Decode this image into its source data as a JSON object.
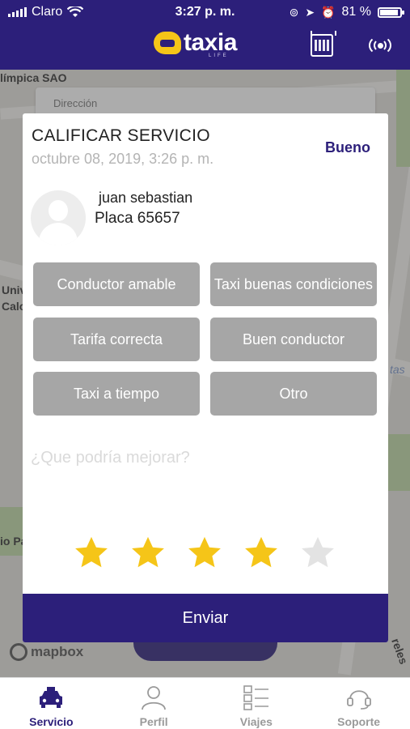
{
  "status": {
    "carrier": "Claro",
    "time": "3:27 p. m.",
    "battery": "81 %"
  },
  "header": {
    "brand": "taxia",
    "brand_sub": "LIFE",
    "calendar_icon": "calendar-icon",
    "signal_icon": "broadcast-icon"
  },
  "map": {
    "labels": [
      "límpica SAO",
      "Univ",
      "Calo",
      "io Pa",
      "tas",
      "reles"
    ],
    "address_placeholder": "Dirección",
    "attribution": "mapbox"
  },
  "modal": {
    "title": "CALIFICAR SERVICIO",
    "date": "octubre 08, 2019, 3:26 p. m.",
    "quality": "Bueno",
    "driver_name": "juan sebastian",
    "plate": "Placa 65657",
    "options": [
      "Conductor amable",
      "Taxi buenas condiciones",
      "Tarifa correcta",
      "Buen conductor",
      "Taxi a tiempo",
      "Otro"
    ],
    "improve_placeholder": "¿Que podría mejorar?",
    "rating": 4,
    "rating_max": 5,
    "submit_label": "Enviar"
  },
  "tabs": [
    {
      "label": "Servicio",
      "icon": "taxi-icon",
      "active": true
    },
    {
      "label": "Perfil",
      "icon": "user-icon",
      "active": false
    },
    {
      "label": "Viajes",
      "icon": "list-icon",
      "active": false
    },
    {
      "label": "Soporte",
      "icon": "headset-icon",
      "active": false
    }
  ],
  "colors": {
    "primary": "#2c1f7a",
    "accent": "#f5c518",
    "option_bg": "#a6a6a6",
    "star_on": "#f5c518",
    "star_off": "#e3e3e3"
  }
}
